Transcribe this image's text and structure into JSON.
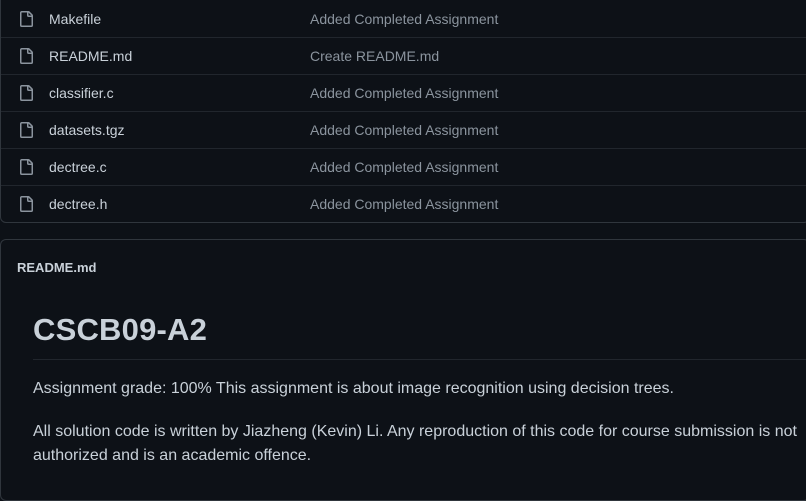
{
  "files": [
    {
      "name": "Makefile",
      "commit": "Added Completed Assignment",
      "icon": "file-icon"
    },
    {
      "name": "README.md",
      "commit": "Create README.md",
      "icon": "file-icon"
    },
    {
      "name": "classifier.c",
      "commit": "Added Completed Assignment",
      "icon": "file-icon"
    },
    {
      "name": "datasets.tgz",
      "commit": "Added Completed Assignment",
      "icon": "file-icon"
    },
    {
      "name": "dectree.c",
      "commit": "Added Completed Assignment",
      "icon": "file-icon"
    },
    {
      "name": "dectree.h",
      "commit": "Added Completed Assignment",
      "icon": "file-icon"
    }
  ],
  "readme": {
    "header": "README.md",
    "title": "CSCB09-A2",
    "paragraph1": "Assignment grade: 100% This assignment is about image recognition using decision trees.",
    "paragraph2": "All solution code is written by Jiazheng (Kevin) Li. Any reproduction of this code for course submission is not authorized and is an academic offence."
  },
  "colors": {
    "background": "#0d1117",
    "border": "#30363d",
    "text": "#c9d1d9",
    "muted": "#8b949e"
  }
}
